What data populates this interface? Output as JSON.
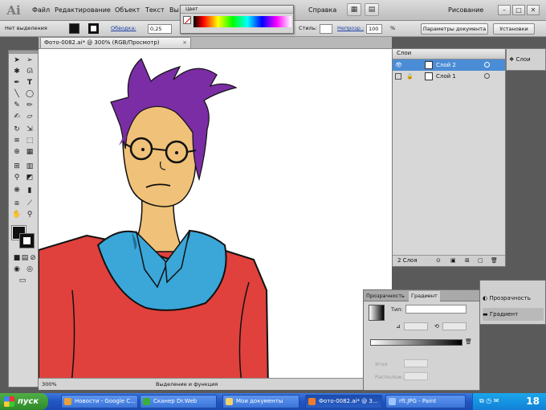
{
  "app": {
    "logo": "Ai"
  },
  "menu": {
    "items": [
      "Файл",
      "Редактирование",
      "Объект",
      "Текст",
      "Вы",
      "Справка"
    ],
    "workspace": "Рисование",
    "window_buttons": [
      "–",
      "□",
      "✕"
    ]
  },
  "color_panel": {
    "title": "Цвет"
  },
  "control_bar": {
    "selection_label": "Нет выделения",
    "stroke_label": "Обводка:",
    "stroke_value": "0,25",
    "style_label": "Стиль:",
    "opacity_label": "Непрозр.:",
    "opacity_value": "100",
    "percent": "%",
    "doc_settings": "Параметры документа",
    "preferences": "Установки"
  },
  "document": {
    "tab_title": "Фото-0082.ai* @ 300% (RGB/Просмотр)",
    "close": "×",
    "zoom": "300%",
    "status": "Выделение и функция"
  },
  "layers_panel": {
    "tab": "Слои",
    "layers": [
      {
        "name": "Слой 2",
        "selected": true
      },
      {
        "name": "Слой 1",
        "selected": false
      }
    ],
    "footer": "2 Слоя"
  },
  "right_dock": {
    "item": "Слои"
  },
  "gradient_panel": {
    "tab_transparency": "Прозрачность",
    "tab_gradient": "Градиент",
    "type_label": "Тип:",
    "angle_label": "Угол",
    "location_label": "Располож."
  },
  "side_panel": {
    "transparency": "Прозрачность",
    "gradient": "Градиент"
  },
  "taskbar": {
    "start": "пуск",
    "tasks": [
      {
        "label": "Новости - Google C...",
        "color": "#e8a13a",
        "active": false
      },
      {
        "label": "Сканер Dr.Web",
        "color": "#3cb03c",
        "active": false
      },
      {
        "label": "Мои документы",
        "color": "#f2d36b",
        "active": false
      },
      {
        "label": "Фото-0082.ai* @ 3...",
        "color": "#f07b2d",
        "active": true
      },
      {
        "label": "rft.JPG - Paint",
        "color": "#9fc4ff",
        "active": false
      }
    ],
    "clock": "18"
  }
}
